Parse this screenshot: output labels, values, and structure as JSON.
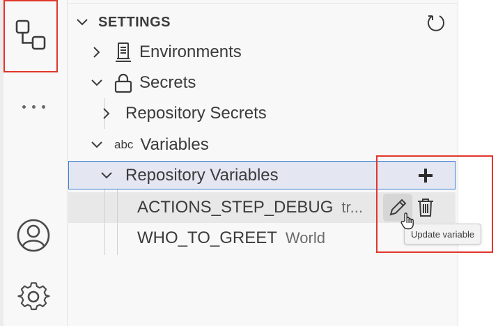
{
  "activity_bar": {
    "active_item": "remote-explorer-icon",
    "more_icon": "ellipsis-icon",
    "account_icon": "account-icon",
    "manage_icon": "gear-icon"
  },
  "section": {
    "title": "SETTINGS",
    "refresh_icon": "refresh-icon"
  },
  "tree": {
    "environments": "Environments",
    "secrets": "Secrets",
    "repository_secrets": "Repository Secrets",
    "variables_prefix": "abc",
    "variables": "Variables",
    "repository_variables": "Repository Variables"
  },
  "variables": [
    {
      "name": "ACTIONS_STEP_DEBUG",
      "value": "tr..."
    },
    {
      "name": "WHO_TO_GREET",
      "value": "World"
    }
  ],
  "actions": {
    "add_icon": "plus-icon",
    "edit_icon": "pencil-icon",
    "delete_icon": "trash-icon"
  },
  "tooltip": {
    "text": "Update variable"
  },
  "colors": {
    "highlight_border": "#e0362c",
    "selection_border": "#3c7fd1",
    "selection_bg": "#e4e6f1"
  }
}
